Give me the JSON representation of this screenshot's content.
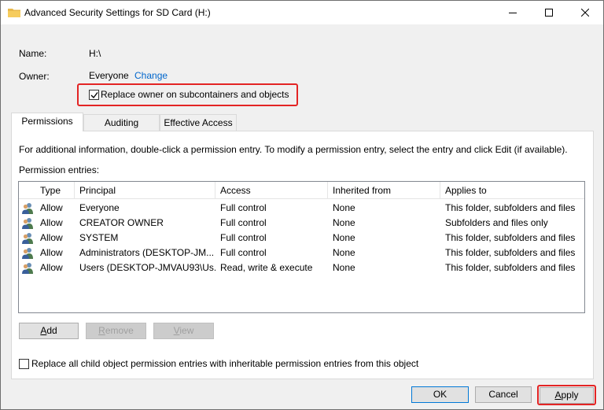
{
  "window": {
    "title": "Advanced Security Settings for SD Card (H:)"
  },
  "fields": {
    "name_label": "Name:",
    "name_value": "H:\\",
    "owner_label": "Owner:",
    "owner_value": "Everyone",
    "change_link": "Change",
    "replace_owner_label": "Replace owner on subcontainers and objects",
    "replace_owner_checked": true
  },
  "tabs": [
    {
      "label": "Permissions",
      "active": true
    },
    {
      "label": "Auditing",
      "active": false
    },
    {
      "label": "Effective Access",
      "active": false
    }
  ],
  "permissions": {
    "info_text": "For additional information, double-click a permission entry. To modify a permission entry, select the entry and click Edit (if available).",
    "entries_label": "Permission entries:",
    "columns": [
      "Type",
      "Principal",
      "Access",
      "Inherited from",
      "Applies to"
    ],
    "rows": [
      {
        "type": "Allow",
        "principal": "Everyone",
        "access": "Full control",
        "inherited": "None",
        "applies": "This folder, subfolders and files"
      },
      {
        "type": "Allow",
        "principal": "CREATOR OWNER",
        "access": "Full control",
        "inherited": "None",
        "applies": "Subfolders and files only"
      },
      {
        "type": "Allow",
        "principal": "SYSTEM",
        "access": "Full control",
        "inherited": "None",
        "applies": "This folder, subfolders and files"
      },
      {
        "type": "Allow",
        "principal": "Administrators (DESKTOP-JM...",
        "access": "Full control",
        "inherited": "None",
        "applies": "This folder, subfolders and files"
      },
      {
        "type": "Allow",
        "principal": "Users (DESKTOP-JMVAU93\\Us...",
        "access": "Read, write & execute",
        "inherited": "None",
        "applies": "This folder, subfolders and files"
      }
    ],
    "add_button": "Add",
    "remove_button": "Remove",
    "view_button": "View",
    "replace_child_label": "Replace all child object permission entries with inheritable permission entries from this object",
    "replace_child_checked": false
  },
  "footer": {
    "ok_button": "OK",
    "cancel_button": "Cancel",
    "apply_button": "Apply"
  },
  "colors": {
    "highlight": "#e32424",
    "link": "#0066cc",
    "default_button_border": "#0078d7"
  }
}
